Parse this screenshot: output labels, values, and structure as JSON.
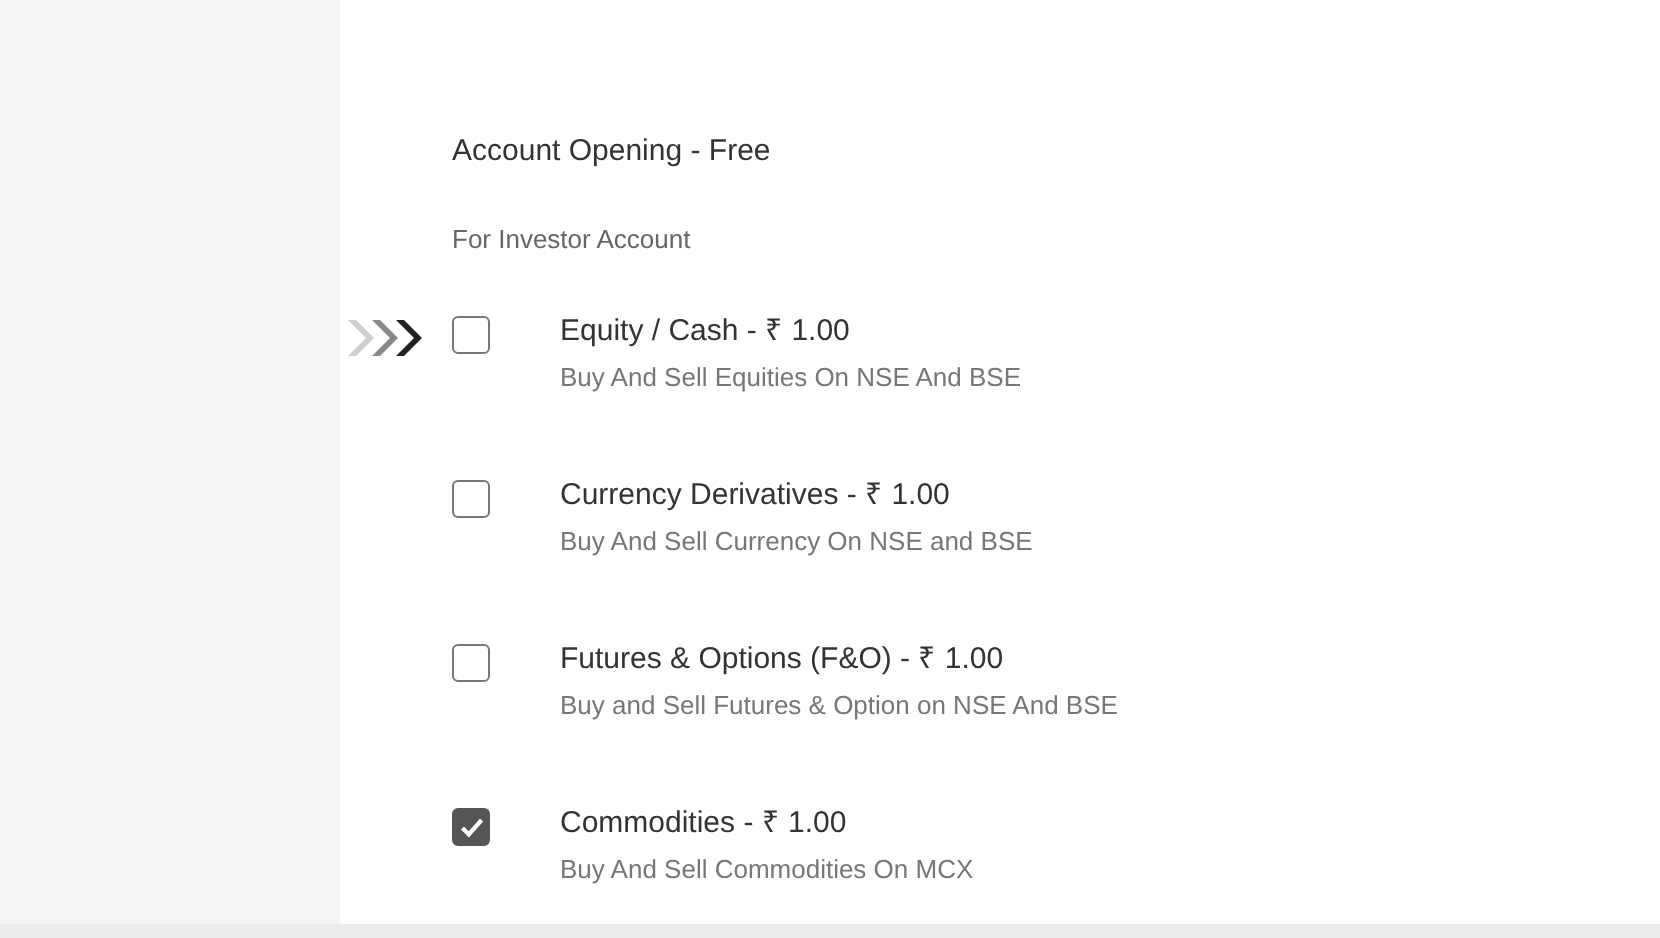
{
  "heading": "Account Opening - Free",
  "subheading": "For Investor Account",
  "segments": [
    {
      "title": "Equity / Cash - ₹ 1.00",
      "description": "Buy And Sell Equities On NSE And BSE",
      "checked": false,
      "pointer": true
    },
    {
      "title": "Currency Derivatives - ₹ 1.00",
      "description": "Buy And Sell Currency On NSE and BSE",
      "checked": false,
      "pointer": false
    },
    {
      "title": "Futures & Options (F&O) - ₹ 1.00",
      "description": "Buy and Sell Futures & Option on NSE And BSE",
      "checked": false,
      "pointer": false
    },
    {
      "title": "Commodities - ₹ 1.00",
      "description": "Buy And Sell Commodities On MCX",
      "checked": true,
      "pointer": false
    }
  ]
}
